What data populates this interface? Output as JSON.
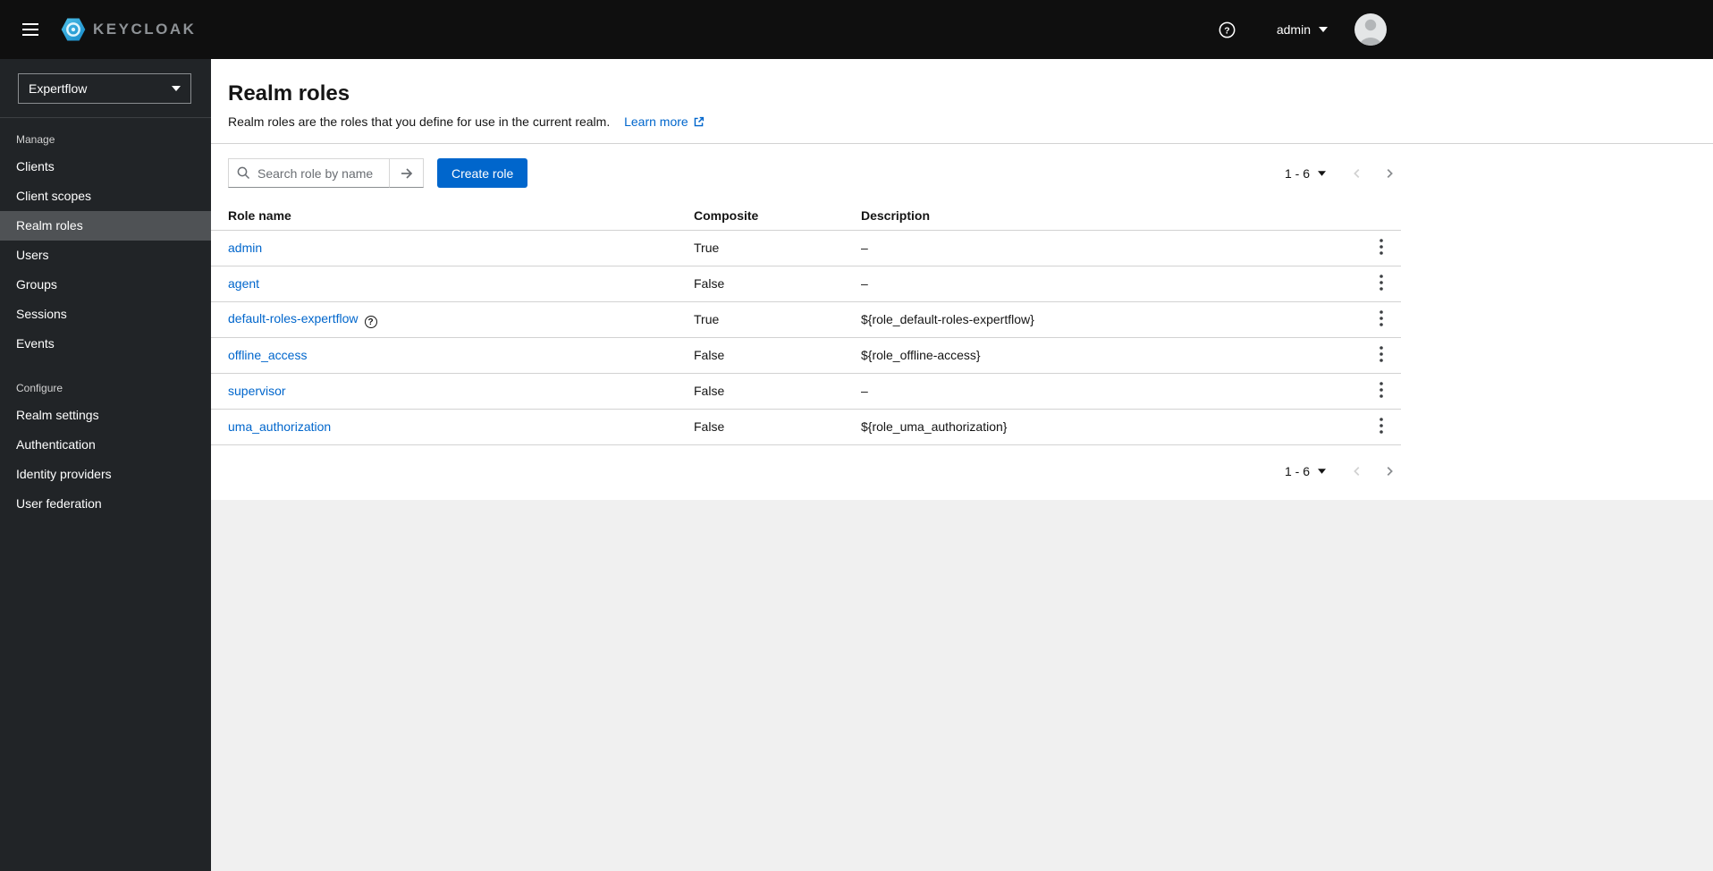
{
  "topbar": {
    "brand": "KEYCLOAK",
    "username": "admin"
  },
  "sidebar": {
    "realm": "Expertflow",
    "sections": [
      {
        "label": "Manage",
        "items": [
          {
            "label": "Clients"
          },
          {
            "label": "Client scopes"
          },
          {
            "label": "Realm roles",
            "current": true
          },
          {
            "label": "Users"
          },
          {
            "label": "Groups"
          },
          {
            "label": "Sessions"
          },
          {
            "label": "Events"
          }
        ]
      },
      {
        "label": "Configure",
        "items": [
          {
            "label": "Realm settings"
          },
          {
            "label": "Authentication"
          },
          {
            "label": "Identity providers"
          },
          {
            "label": "User federation"
          }
        ]
      }
    ]
  },
  "main": {
    "title": "Realm roles",
    "description": "Realm roles are the roles that you define for use in the current realm.",
    "learn_more": "Learn more",
    "toolbar": {
      "search_placeholder": "Search role by name",
      "create_label": "Create role"
    },
    "pagination": {
      "label": "1 - 6"
    },
    "table": {
      "headers": [
        "Role name",
        "Composite",
        "Description"
      ],
      "rows": [
        {
          "name": "admin",
          "composite": "True",
          "description": "–"
        },
        {
          "name": "agent",
          "composite": "False",
          "description": "–"
        },
        {
          "name": "default-roles-expertflow",
          "composite": "True",
          "description": "${role_default-roles-expertflow}"
        },
        {
          "name": "offline_access",
          "composite": "False",
          "description": "${role_offline-access}"
        },
        {
          "name": "supervisor",
          "composite": "False",
          "description": "–"
        },
        {
          "name": "uma_authorization",
          "composite": "False",
          "description": "${role_uma_authorization}"
        }
      ]
    }
  },
  "icons": {
    "help_glyph": "?"
  },
  "colors": {
    "primary": "#0066cc",
    "link": "#0066cc",
    "masthead_bg": "#0f0f0f",
    "sidebar_bg": "#212427",
    "sidebar_current_bg": "#4f5255",
    "brand_cyan": "#29abe2",
    "page_background_gray": "#f0f0f0"
  }
}
